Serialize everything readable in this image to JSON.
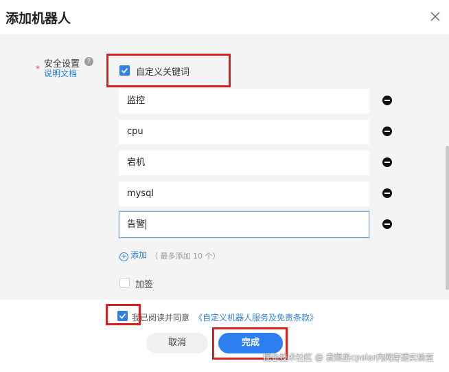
{
  "dialog": {
    "title": "添加机器人",
    "close_icon": "close-icon"
  },
  "security": {
    "required_mark": "*",
    "label": "安全设置",
    "help_icon": "?",
    "doc_link": "说明文档",
    "custom_keywords_label": "自定义关键词",
    "custom_keywords_checked": true,
    "keywords": [
      {
        "value": "监控"
      },
      {
        "value": "cpu"
      },
      {
        "value": "宕机"
      },
      {
        "value": "mysql"
      },
      {
        "value": "告警"
      }
    ],
    "add_label": "添加",
    "add_hint": "（ 最多添加 10 个）",
    "sign_label": "加签",
    "sign_checked": false
  },
  "agreement": {
    "checked": true,
    "text": "我已阅读并同意",
    "link": "《自定义机器人服务及免责条款》"
  },
  "buttons": {
    "cancel": "取消",
    "done": "完成"
  },
  "watermark": "掘金技术社区 @ 袁熙丞cpolar内网穿透实验室",
  "colors": {
    "accent": "#2d7ef0",
    "highlight_box": "#d9211f",
    "link": "#2e7fd6"
  }
}
